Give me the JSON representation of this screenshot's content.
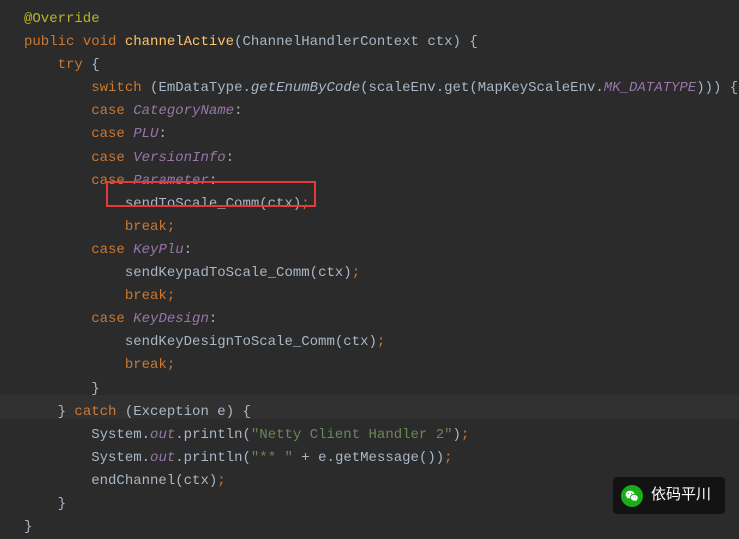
{
  "code": {
    "annotation": "@Override",
    "kw_public": "public",
    "kw_void": "void",
    "method": "channelActive",
    "param_type": "ChannelHandlerContext",
    "param_name": "ctx",
    "kw_try": "try",
    "kw_switch": "switch",
    "enum_class": "EmDataType",
    "enum_method": "getEnumByCode",
    "scale_env": "scaleEnv",
    "get": "get",
    "map_key_class": "MapKeyScaleEnv",
    "mk_const": "MK_DATATYPE",
    "kw_case": "case",
    "case1": "CategoryName",
    "case2": "PLU",
    "case3": "VersionInfo",
    "case4": "Parameter",
    "call1": "sendToScale_Comm",
    "ctx": "ctx",
    "kw_break": "break",
    "case5": "KeyPlu",
    "call2": "sendKeypadToScale_Comm",
    "case6": "KeyDesign",
    "call3": "sendKeyDesignToScale_Comm",
    "kw_catch": "catch",
    "exc_type": "Exception",
    "exc_name": "e",
    "system": "System",
    "out": "out",
    "println": "println",
    "str1": "\"Netty Client Handler 2\"",
    "str2a": "\"** \"",
    "plus": " + ",
    "get_msg": "getMessage",
    "end_channel": "endChannel"
  },
  "watermark": {
    "text": "依码平川"
  }
}
